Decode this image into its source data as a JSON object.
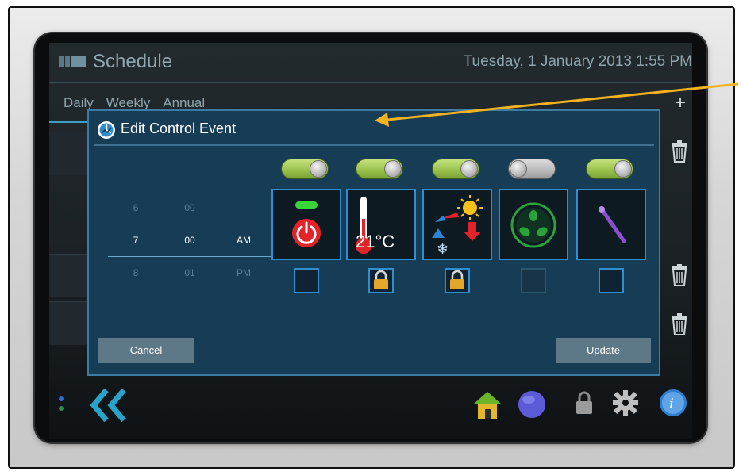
{
  "header": {
    "title": "Schedule",
    "datetime": "Tuesday, 1 January 2013 1:55 PM"
  },
  "tabs": [
    "Daily",
    "Weekly",
    "Annual"
  ],
  "dialog": {
    "title": "Edit Control Event",
    "time_picker": {
      "hours": [
        "6",
        "7",
        "8"
      ],
      "minutes": [
        "00",
        "00",
        "01"
      ],
      "ampm": [
        "",
        "AM",
        "PM"
      ],
      "selected": {
        "hour": "7",
        "minute": "00",
        "ampm": "AM"
      }
    },
    "features": [
      {
        "name": "power",
        "icon": "power-icon",
        "enabled": true,
        "locked": false
      },
      {
        "name": "temperature",
        "icon": "thermometer-icon",
        "value": "21°C",
        "enabled": true,
        "locked": true
      },
      {
        "name": "mode",
        "icon": "heat-cool-mode-icon",
        "enabled": true,
        "locked": true
      },
      {
        "name": "fan",
        "icon": "fan-icon",
        "enabled": false,
        "locked": false
      },
      {
        "name": "vane",
        "icon": "vane-direction-icon",
        "enabled": true,
        "locked": false
      }
    ],
    "cancel_label": "Cancel",
    "update_label": "Update"
  },
  "colors": {
    "accent": "#2f8ed0",
    "dialog_bg": "#173c55",
    "toggle_on": "#97c04a",
    "annotation_arrow": "#f3b21f"
  },
  "toolbar": {
    "icons": [
      "back-double-chevron-icon",
      "home-icon",
      "globe-icon",
      "lock-icon",
      "gear-icon",
      "info-icon"
    ]
  }
}
